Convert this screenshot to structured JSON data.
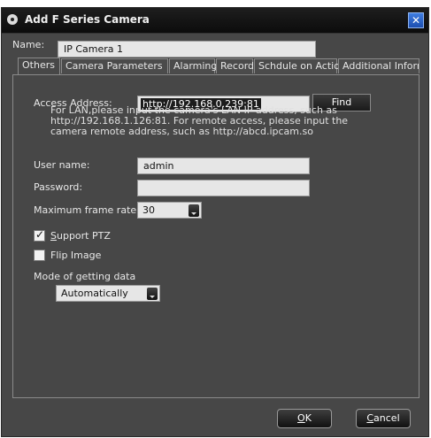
{
  "window": {
    "title": "Add F Series Camera"
  },
  "name_field": {
    "label": "Name:",
    "value": "IP Camera 1"
  },
  "tabs": [
    {
      "label": "Others"
    },
    {
      "label": "Camera Parameters"
    },
    {
      "label": "Alarming"
    },
    {
      "label": "Record"
    },
    {
      "label": "Schdule on Action"
    },
    {
      "label": "Additional Information"
    }
  ],
  "others": {
    "access_address": {
      "label": "Access Address:",
      "value": "http://192.168.0.239:81"
    },
    "find_button": "Find",
    "hint": "For LAN,please input the camera's LAN IP address, such as http://192.168.1.126:81. For remote access, please input the camera remote address, such as http://abcd.ipcam.so",
    "username": {
      "label": "User name:",
      "value": "admin"
    },
    "password": {
      "label": "Password:",
      "value": ""
    },
    "frame_rate": {
      "label": "Maximum frame rate:",
      "value": "30"
    },
    "support_ptz": {
      "label_first": "S",
      "label_rest": "upport PTZ",
      "checked": true
    },
    "flip_image": {
      "label": "Flip Image",
      "checked": false
    },
    "mode": {
      "label": "Mode of getting data",
      "value": "Automatically"
    }
  },
  "buttons": {
    "ok_first": "O",
    "ok_rest": "K",
    "cancel_first": "C",
    "cancel_rest": "ancel"
  }
}
